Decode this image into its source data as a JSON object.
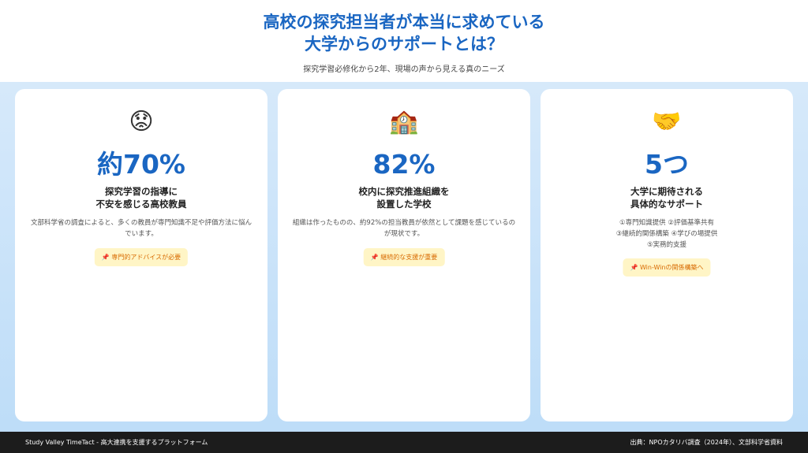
{
  "header": {
    "title_line1": "高校の探究担当者が本当に求めている",
    "title_line2": "大学からのサポートとは？",
    "subtitle": "探究学習必修化から2年、現場の声から見える真のニーズ"
  },
  "cards": [
    {
      "emoji": "😟",
      "icon": "worried-face-icon",
      "stat": "約70%",
      "heading_line1": "探究学習の指導に",
      "heading_line2": "不安を感じる高校教員",
      "description": "文部科学省の調査によると、多くの教員が専門知識不足や評価方法に悩んでいます。",
      "tag": "📌 専門的アドバイスが必要"
    },
    {
      "emoji": "🏫",
      "icon": "school-icon",
      "stat": "82%",
      "heading_line1": "校内に探究推進組織を",
      "heading_line2": "設置した学校",
      "description": "組織は作ったものの、約92%の担当教員が依然として課題を感じているのが現状です。",
      "tag": "📌 継続的な支援が重要"
    },
    {
      "emoji": "🤝",
      "icon": "handshake-icon",
      "stat": "5つ",
      "heading_line1": "大学に期待される",
      "heading_line2": "具体的なサポート",
      "list": [
        "①専門知識提供 ②評価基準共有",
        "③継続的関係構築 ④学びの場提供",
        "⑤実務的支援"
      ],
      "tag": "📌 Win-Winの関係構築へ"
    }
  ],
  "footer": {
    "left": "Study Valley TimeTact - 高大連携を支援するプラットフォーム",
    "right": "出典：NPOカタリバ調査（2024年）、文部科学省資料"
  },
  "colors": {
    "accent": "#1a66c2",
    "tag_bg": "#fff5c6",
    "tag_text": "#d86a00",
    "footer_bg": "#1c1c1c"
  }
}
